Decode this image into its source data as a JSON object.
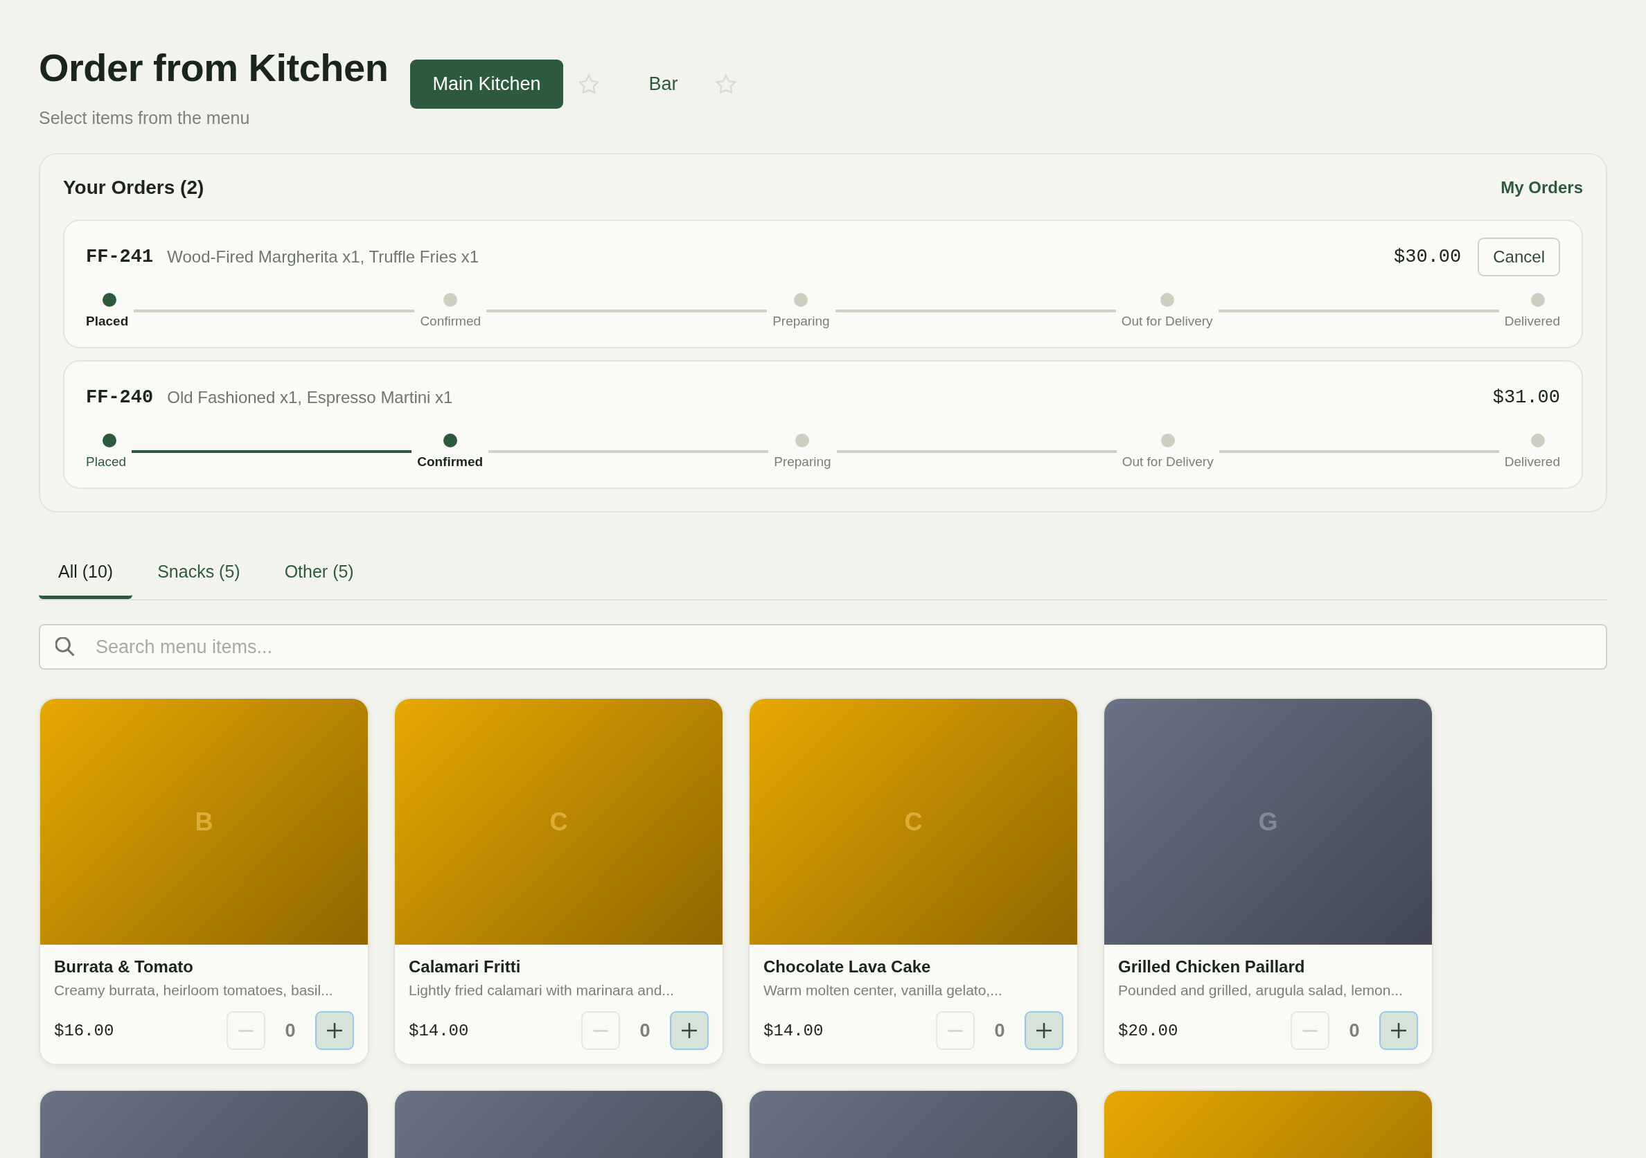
{
  "header": {
    "title": "Order from Kitchen",
    "subtitle": "Select items from the menu"
  },
  "kitchens": [
    {
      "label": "Main Kitchen",
      "selected": true,
      "favorite": false
    },
    {
      "label": "Bar",
      "selected": false,
      "favorite": false
    }
  ],
  "orders_panel": {
    "title": "Your Orders (2)",
    "link": "My Orders",
    "orders": [
      {
        "id": "FF-241",
        "items": "Wood-Fired Margherita x1, Truffle Fries x1",
        "total": "$30.00",
        "cancel": "Cancel",
        "steps": [
          {
            "label": "Placed",
            "done": true,
            "current": true
          },
          {
            "label": "Confirmed",
            "done": false,
            "current": false
          },
          {
            "label": "Preparing",
            "done": false,
            "current": false
          },
          {
            "label": "Out for Delivery",
            "done": false,
            "current": false
          },
          {
            "label": "Delivered",
            "done": false,
            "current": false
          }
        ]
      },
      {
        "id": "FF-240",
        "items": "Old Fashioned x1, Espresso Martini x1",
        "total": "$31.00",
        "steps": [
          {
            "label": "Placed",
            "done": true,
            "current": false
          },
          {
            "label": "Confirmed",
            "done": true,
            "current": true
          },
          {
            "label": "Preparing",
            "done": false,
            "current": false
          },
          {
            "label": "Out for Delivery",
            "done": false,
            "current": false
          },
          {
            "label": "Delivered",
            "done": false,
            "current": false
          }
        ]
      }
    ]
  },
  "category_tabs": [
    {
      "label": "All (10)",
      "selected": true
    },
    {
      "label": "Snacks (5)",
      "selected": false
    },
    {
      "label": "Other (5)",
      "selected": false
    }
  ],
  "search": {
    "placeholder": "Search menu items..."
  },
  "menu_items": [
    {
      "color": "#e8a800",
      "initial": "B",
      "name": "Burrata & Tomato",
      "description": "Creamy burrata, heirloom tomatoes, basil...",
      "price": "$16.00",
      "quantity": "0",
      "minus_disabled": true
    },
    {
      "color": "#e8a800",
      "initial": "C",
      "name": "Calamari Fritti",
      "description": "Lightly fried calamari with marinara and...",
      "price": "$14.00",
      "quantity": "0",
      "minus_disabled": true
    },
    {
      "color": "#e8a800",
      "initial": "C",
      "name": "Chocolate Lava Cake",
      "description": "Warm molten center, vanilla gelato,...",
      "price": "$14.00",
      "quantity": "0",
      "minus_disabled": true
    },
    {
      "color": "#6a7385",
      "initial": "G",
      "name": "Grilled Chicken Paillard",
      "description": "Pounded and grilled, arugula salad, lemon...",
      "price": "$20.00",
      "quantity": "0",
      "minus_disabled": true
    },
    {
      "color": "#6a7385"
    },
    {
      "color": "#6a7385"
    },
    {
      "color": "#6a7385"
    },
    {
      "color": "#e8a800"
    }
  ]
}
